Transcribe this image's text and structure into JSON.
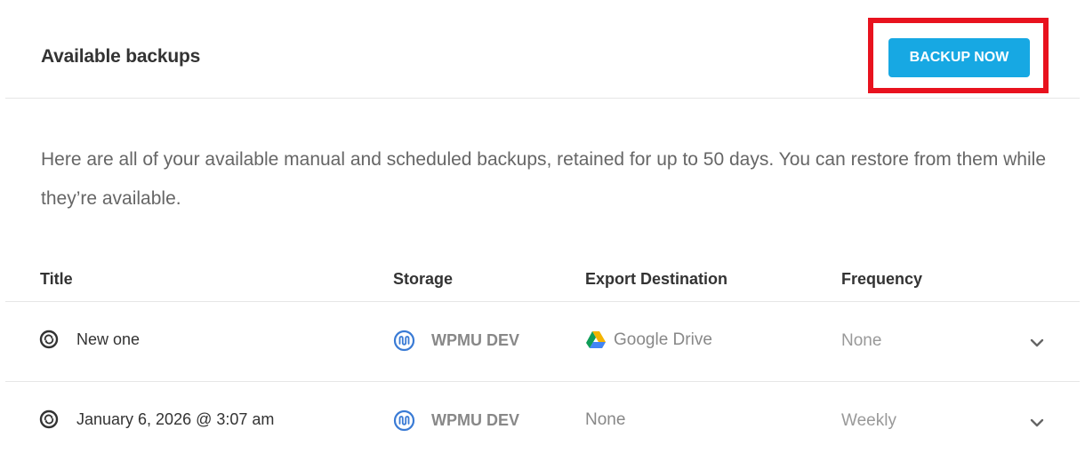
{
  "header": {
    "title": "Available backups",
    "backup_button_label": "BACKUP NOW"
  },
  "description": "Here are all of your available manual and scheduled backups, retained for up to 50 days. You can restore from them while they’re available.",
  "table": {
    "columns": [
      "Title",
      "Storage",
      "Export Destination",
      "Frequency"
    ],
    "rows": [
      {
        "title": "New one",
        "storage": "WPMU DEV",
        "export_destination": "Google Drive",
        "export_icon": "google-drive-icon",
        "frequency": "None"
      },
      {
        "title": "January 6, 2026 @ 3:07 am",
        "storage": "WPMU DEV",
        "export_destination": "None",
        "export_icon": "",
        "frequency": "Weekly"
      }
    ]
  },
  "colors": {
    "accent": "#17a8e3",
    "highlight": "#e8121e",
    "storage_icon": "#3a7bd5"
  },
  "icons": {
    "row_icon": "backup-cycle-icon",
    "storage_icon": "wpmu-dev-icon",
    "expand_icon": "chevron-down-icon"
  }
}
